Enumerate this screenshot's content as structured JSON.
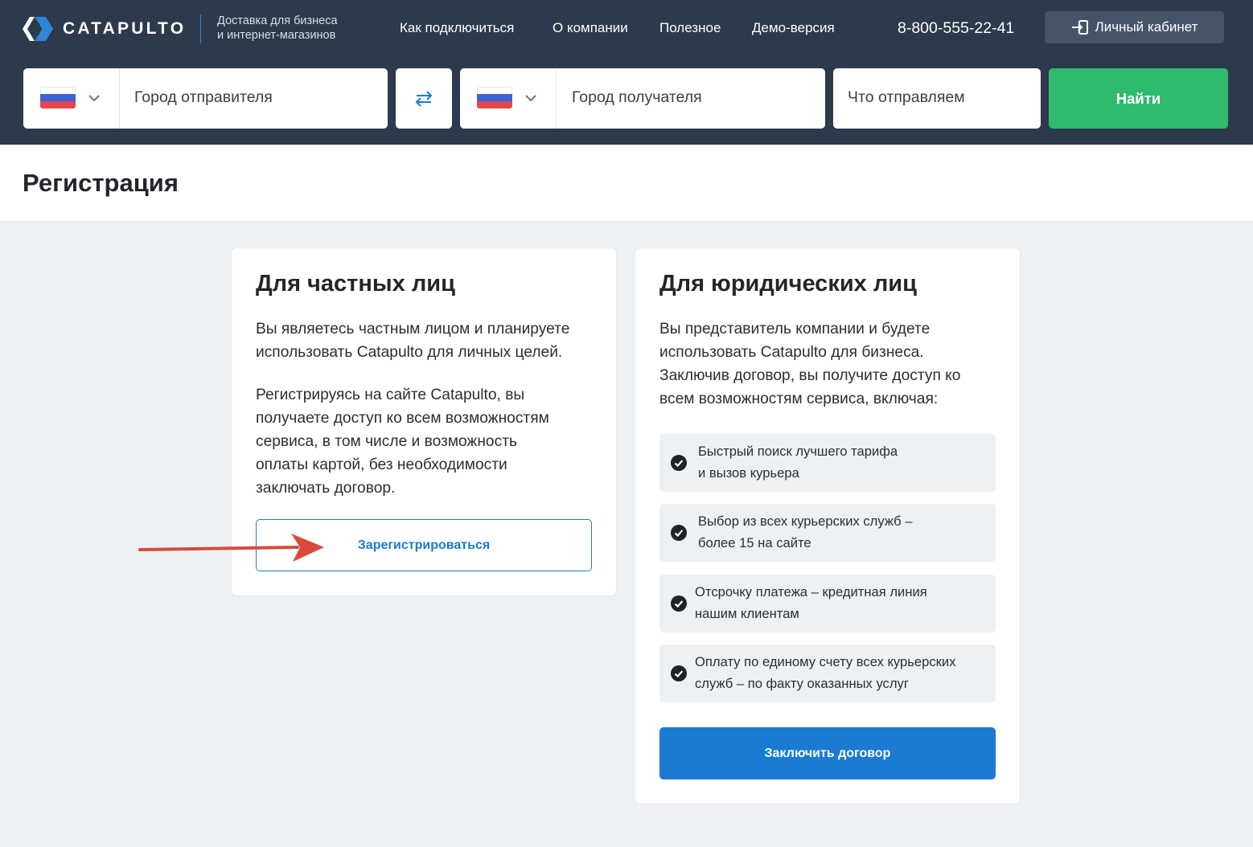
{
  "header": {
    "logo_text": "CATAPULTO",
    "tagline_line1": "Доставка для бизнеса",
    "tagline_line2": "и интернет-магазинов",
    "nav": [
      {
        "label": "Как подключиться"
      },
      {
        "label": "О компании"
      },
      {
        "label": "Полезное"
      },
      {
        "label": "Демо-версия"
      }
    ],
    "phone": "8-800-555-22-41",
    "cabinet_label": "Личный кабинет",
    "colors": {
      "background": "#2d3a4b",
      "accent": "#2f86d6",
      "button": "#475467"
    }
  },
  "search": {
    "sender_city": "Город отправителя",
    "receiver_city": "Город получателя",
    "what": "Что отправляем",
    "find_label": "Найти",
    "find_color": "#2fba6f",
    "country_flag": "russia-flag-icon"
  },
  "page": {
    "title": "Регистрация"
  },
  "individuals": {
    "title": "Для частных лиц",
    "p1_line1": "Вы являетесь частным лицом и планируете",
    "p1_line2": "использовать Catapulto для личных целей.",
    "p2_line1": "Регистрируясь на сайте Catapulto, вы",
    "p2_line2": "получаете доступ ко всем возможностям",
    "p2_line3": "сервиса, в том числе и возможность",
    "p2_line4": "оплаты картой, без необходимости",
    "p2_line5": "заключать договор.",
    "register_label": "Зарегистрироваться"
  },
  "companies": {
    "title": "Для юридических лиц",
    "p_line1": "Вы представитель компании и будете",
    "p_line2": "использовать Catapulto для бизнеса.",
    "p_line3": "Заключив договор, вы получите доступ ко",
    "p_line4": "всем возможностям сервиса, включая:",
    "features": [
      {
        "line1": "Быстрый поиск лучшего тарифа",
        "line2": "и вызов курьера"
      },
      {
        "line1": "Выбор из всех курьерских служб –",
        "line2": "более 15 на сайте"
      },
      {
        "line1": "Отсрочку платежа – кредитная линия",
        "line2": "нашим клиентам"
      },
      {
        "line1": "Оплату по единому счету всех курьерских",
        "line2": "служб – по факту оказанных услуг"
      }
    ],
    "contract_label": "Заключить договор",
    "contract_color": "#1b7bd3"
  },
  "annotation": {
    "arrow_color": "#d94a3d",
    "arrow_icon": "red-arrow-icon"
  }
}
